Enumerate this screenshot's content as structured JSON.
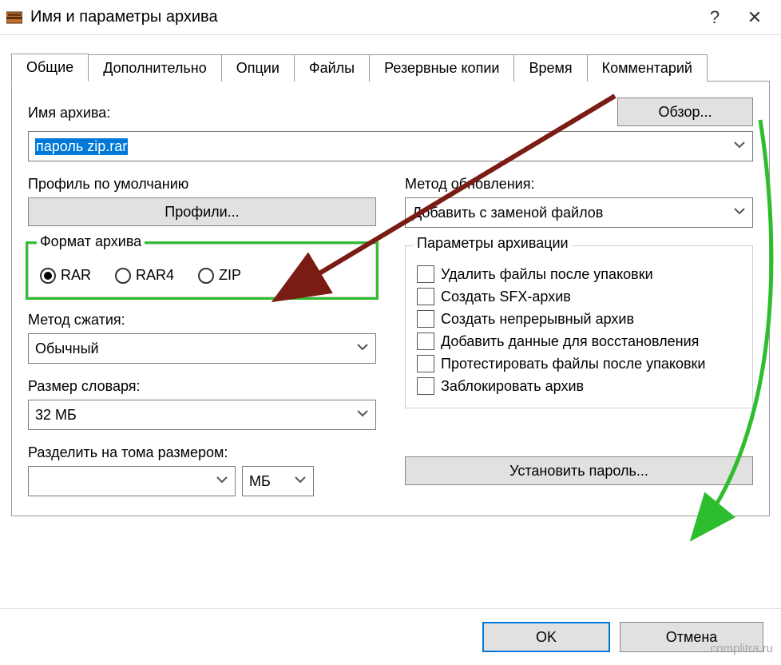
{
  "window": {
    "title": "Имя и параметры архива"
  },
  "tabs": {
    "general": "Общие",
    "advanced": "Дополнительно",
    "options": "Опции",
    "files": "Файлы",
    "backup": "Резервные копии",
    "time": "Время",
    "comment": "Комментарий"
  },
  "archive": {
    "name_label": "Имя архива:",
    "browse": "Обзор...",
    "value": "пароль zip.rar"
  },
  "profile": {
    "label": "Профиль по умолчанию",
    "button": "Профили..."
  },
  "update": {
    "label": "Метод обновления:",
    "value": "Добавить с заменой файлов"
  },
  "format": {
    "legend": "Формат архива",
    "rar": "RAR",
    "rar4": "RAR4",
    "zip": "ZIP",
    "selected": "rar"
  },
  "compression": {
    "method_label": "Метод сжатия:",
    "method_value": "Обычный",
    "dict_label": "Размер словаря:",
    "dict_value": "32 МБ",
    "split_label": "Разделить на тома размером:",
    "split_value": "",
    "split_unit": "МБ"
  },
  "params": {
    "legend": "Параметры архивации",
    "opt_delete": "Удалить файлы после упаковки",
    "opt_sfx": "Создать SFX-архив",
    "opt_solid": "Создать непрерывный архив",
    "opt_recovery": "Добавить данные для восстановления",
    "opt_test": "Протестировать файлы после упаковки",
    "opt_lock": "Заблокировать архив"
  },
  "password_btn": "Установить пароль...",
  "buttons": {
    "ok": "OK",
    "cancel": "Отмена"
  },
  "watermark": "complitra.ru"
}
